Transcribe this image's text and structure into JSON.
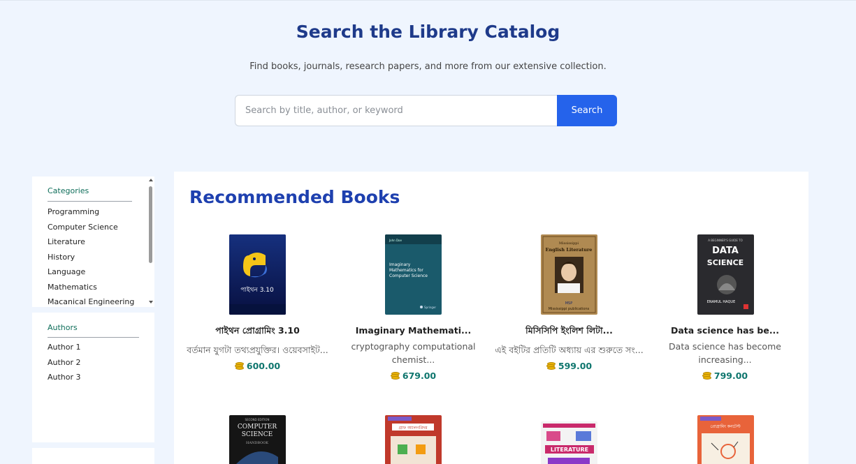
{
  "hero": {
    "title": "Search the Library Catalog",
    "subtitle": "Find books, journals, research papers, and more from our extensive collection."
  },
  "search": {
    "placeholder": "Search by title, author, or keyword",
    "button_label": "Search"
  },
  "sidebar": {
    "categories": {
      "title": "Categories",
      "items": [
        "Programming",
        "Computer Science",
        "Literature",
        "History",
        "Language",
        "Mathematics",
        "Macanical Engineering"
      ]
    },
    "authors": {
      "title": "Authors",
      "items": [
        "Author 1",
        "Author 2",
        "Author 3"
      ]
    }
  },
  "main": {
    "section_title": "Recommended Books",
    "books": [
      {
        "title": "পাইথন প্রোগ্রামিং 3.10",
        "description": "বর্তমান যুগটা তথ্যপ্রযুক্তির। ওয়েবসাইট...",
        "price": "600.00",
        "cover_color": "#0b1b5c",
        "cover_text": "পাইথন প্রোগ্রামিং 3.10"
      },
      {
        "title": "Imaginary Mathemati...",
        "description": "cryptography computational chemist...",
        "price": "679.00",
        "cover_color": "#1a5a6b",
        "cover_text": "Imaginary Mathematics for Computer Science"
      },
      {
        "title": "মিসিসিপি ইংলিশ লিটা...",
        "description": "এই বইটির প্রতিটি অধ্যায় এর শুরুতে সং...",
        "price": "599.00",
        "cover_color": "#b08a52",
        "cover_text": "Mississippi English Literature"
      },
      {
        "title": "Data science has be...",
        "description": "Data science has become increasing...",
        "price": "799.00",
        "cover_color": "#2a2a2e",
        "cover_text": "DATA SCIENCE"
      }
    ],
    "row2_covers": [
      {
        "cover_color": "#151515",
        "cover_text": "COMPUTER SCIENCE"
      },
      {
        "cover_color": "#c0392b",
        "cover_text": "গ্রাফ অ্যালগরিদম"
      },
      {
        "cover_color": "#f3f3f3",
        "cover_text": "THE LITERATURE"
      },
      {
        "cover_color": "#e8633a",
        "cover_text": "প্রোগ্রামিং কনটেস্ট"
      }
    ]
  },
  "colors": {
    "accent": "#2563eb",
    "heading": "#1e3a8a",
    "price": "#0f766e"
  }
}
